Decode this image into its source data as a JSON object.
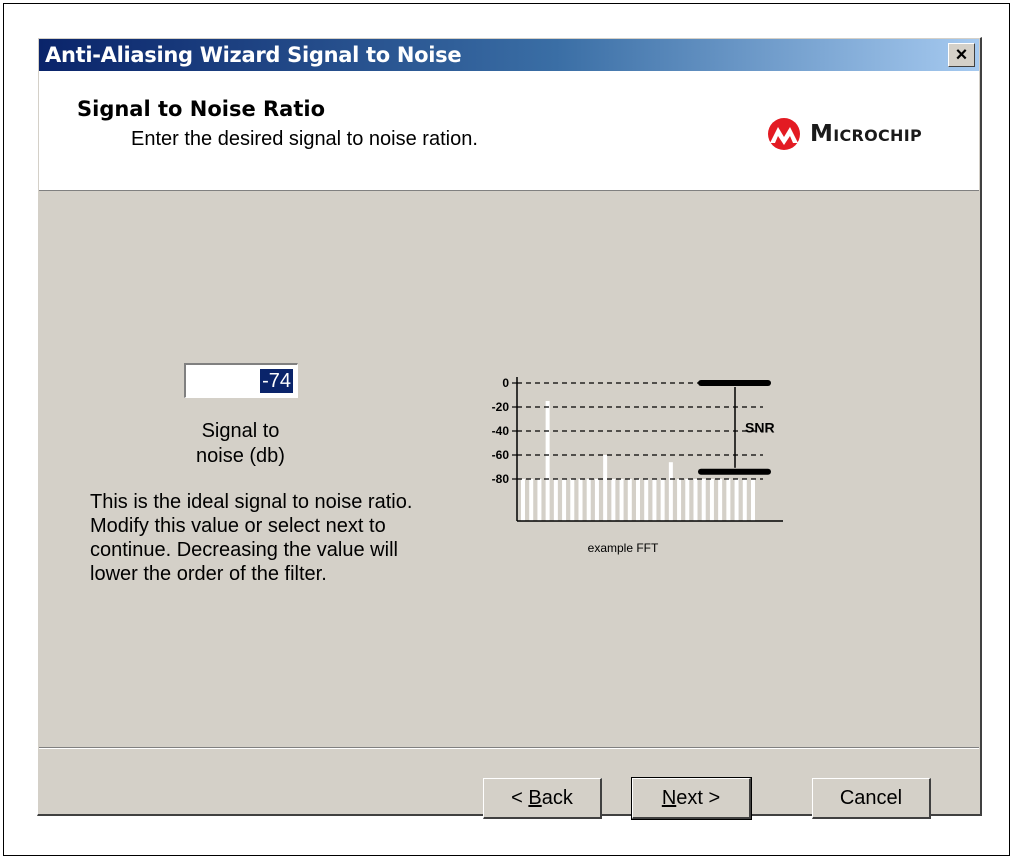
{
  "window": {
    "title": "Anti-Aliasing Wizard Signal to Noise",
    "close_label": "×"
  },
  "header": {
    "title": "Signal to Noise Ratio",
    "subtitle": "Enter the desired signal to noise ration.",
    "logo_text": "Microchip"
  },
  "snr": {
    "value": "-74",
    "label_line1": "Signal to",
    "label_line2": "noise (db)"
  },
  "description": "This is the ideal signal to noise ratio.  Modify this value or select next to continue. Decreasing the value will lower the order of the filter.",
  "chart_data": {
    "type": "bar",
    "title": "",
    "xlabel": "example FFT",
    "ylabel": "",
    "y_ticks": [
      "0",
      "-20",
      "-40",
      "-60",
      "-80"
    ],
    "ylim": [
      -115,
      0
    ],
    "annotation": "SNR",
    "snr_levels": [
      0,
      -74
    ],
    "values": [
      -80,
      -80,
      -80,
      -15,
      -80,
      -80,
      -80,
      -80,
      -80,
      -80,
      -60,
      -80,
      -80,
      -80,
      -80,
      -80,
      -80,
      -80,
      -66,
      -80,
      -80,
      -80,
      -80,
      -80,
      -80,
      -80,
      -80,
      -80,
      -80
    ],
    "grid": true,
    "bar_color": "#ffffff"
  },
  "buttons": {
    "back_prefix": "< ",
    "back_mnemonic": "B",
    "back_rest": "ack",
    "next_mnemonic": "N",
    "next_rest": "ext >",
    "cancel": "Cancel"
  },
  "colors": {
    "title_bar": "#0a246a",
    "dialog_face": "#d4d0c8",
    "selection": "#0a246a",
    "logo_red": "#e31b23"
  }
}
